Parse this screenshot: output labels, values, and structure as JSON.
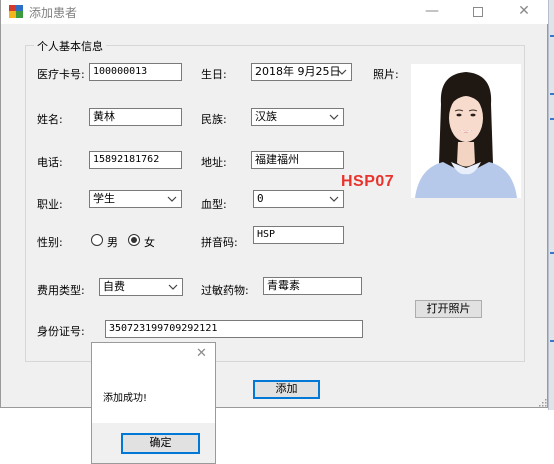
{
  "window": {
    "title": "添加患者",
    "controls": {
      "minimize": "—",
      "close": "✕"
    }
  },
  "group": {
    "title": "个人基本信息"
  },
  "form": {
    "card_no": {
      "label": "医疗卡号:",
      "value": "100000013"
    },
    "birthday": {
      "label": "生日:",
      "value": "2018年 9月25日"
    },
    "photo_label": "照片:",
    "name": {
      "label": "姓名:",
      "value": "黄林"
    },
    "ethnicity": {
      "label": "民族:",
      "value": "汉族"
    },
    "phone": {
      "label": "电话:",
      "value": "15892181762"
    },
    "address": {
      "label": "地址:",
      "value": "福建福州"
    },
    "occupation": {
      "label": "职业:",
      "value": "学生"
    },
    "blood_type": {
      "label": "血型:",
      "value": "0"
    },
    "gender": {
      "label": "性别:",
      "options": [
        "男",
        "女"
      ],
      "selected": "女"
    },
    "pinyin": {
      "label": "拼音码:",
      "value": "HSP"
    },
    "fee_type": {
      "label": "费用类型:",
      "value": "自费"
    },
    "allergy": {
      "label": "过敏药物:",
      "value": "青霉素"
    },
    "id_card": {
      "label": "身份证号:",
      "value": "350723199709292121"
    }
  },
  "photo": {
    "icon": "portrait-photo"
  },
  "stamp": "HSP07",
  "buttons": {
    "open_photo": "打开照片",
    "add": "添加"
  },
  "dialog": {
    "message": "添加成功!",
    "ok": "确定",
    "close": "✕"
  }
}
